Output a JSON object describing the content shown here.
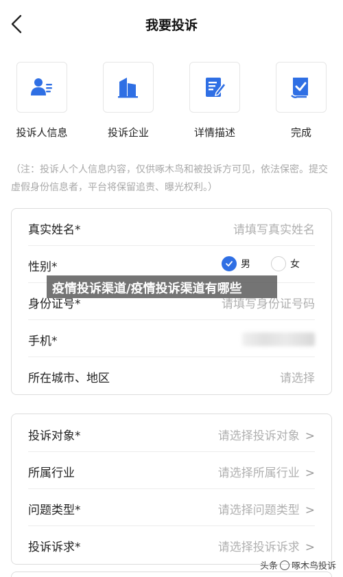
{
  "header": {
    "title": "我要投诉"
  },
  "steps": [
    {
      "label": "投诉人信息",
      "icon": "person-info-icon"
    },
    {
      "label": "投诉企业",
      "icon": "building-icon"
    },
    {
      "label": "详情描述",
      "icon": "edit-document-icon"
    },
    {
      "label": "完成",
      "icon": "checked-document-icon"
    }
  ],
  "notice": "（注：投诉人个人信息内容，仅供啄木鸟和被投诉方可见，依法保密。提交虚假身份信息者，平台将保留追责、曝光权利。）",
  "personal": {
    "name": {
      "label": "真实姓名*",
      "placeholder": "请填写真实姓名"
    },
    "gender": {
      "label": "性别*",
      "male": "男",
      "female": "女",
      "selected": "男"
    },
    "id_number": {
      "label": "身份证号*",
      "placeholder": "请填写身份证号码"
    },
    "phone": {
      "label": "手机*"
    },
    "city": {
      "label": "所在城市、地区",
      "placeholder": "请选择"
    }
  },
  "complaint": {
    "target": {
      "label": "投诉对象*",
      "placeholder": "请选择投诉对象",
      "arrow": ">"
    },
    "industry": {
      "label": "所属行业",
      "placeholder": "请选择所属行业",
      "arrow": ">"
    },
    "issue_type": {
      "label": "问题类型*",
      "placeholder": "请选择问题类型",
      "arrow": ">"
    },
    "demand": {
      "label": "投诉诉求*",
      "placeholder": "请选择投诉诉求",
      "arrow": ">"
    }
  },
  "banner": {
    "text": "疫情投诉渠道/疫情投诉渠道有哪些"
  },
  "watermark": {
    "prefix": "头条",
    "suffix": "啄木鸟投诉"
  },
  "colors": {
    "accent": "#2f6fe4",
    "placeholder": "#b0b0b0"
  }
}
